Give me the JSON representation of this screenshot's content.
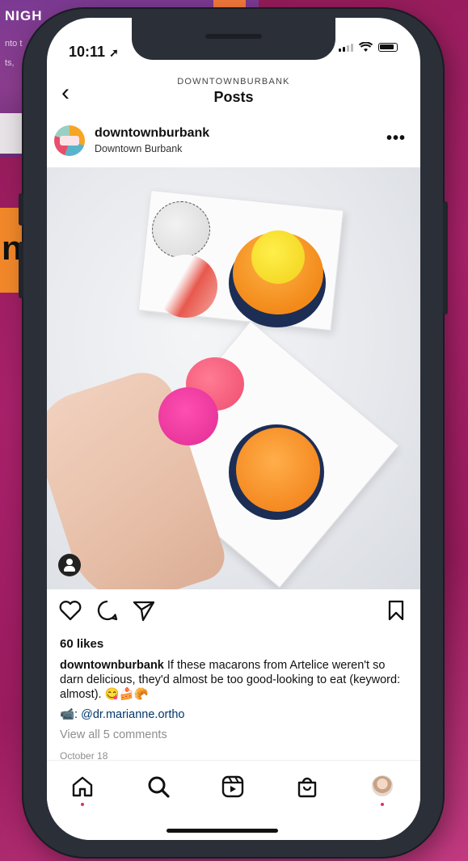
{
  "background": {
    "heading": "NIGH",
    "line1": "nto t",
    "line2": "ts,",
    "orange_label": "n",
    "colors": {
      "magenta": "#a8216a",
      "orange": "#f2882a",
      "purple": "#7b3a92"
    }
  },
  "status_bar": {
    "time": "10:11",
    "location_glyph": "➚"
  },
  "header": {
    "back_glyph": "‹",
    "account": "DOWNTOWNBURBANK",
    "title": "Posts"
  },
  "post": {
    "username": "downtownburbank",
    "location": "Downtown Burbank",
    "more_glyph": "•••",
    "likes": "60 likes",
    "caption_user": "downtownburbank",
    "caption_text": " If these macarons from Artelice weren't so darn delicious, they'd almost be too good-looking to eat (keyword: almost). 😋🍰🥐",
    "mention_prefix": "📹: ",
    "mention": "@dr.marianne.ortho",
    "view_comments": "View all 5 comments",
    "date": "October 18"
  },
  "icons": {
    "like": "heart-icon",
    "comment": "comment-icon",
    "share": "send-icon",
    "save": "bookmark-icon",
    "home": "home-icon",
    "search": "search-icon",
    "reels": "reels-icon",
    "shop": "shop-icon",
    "profile": "profile-avatar"
  },
  "accent": "#e1306c"
}
